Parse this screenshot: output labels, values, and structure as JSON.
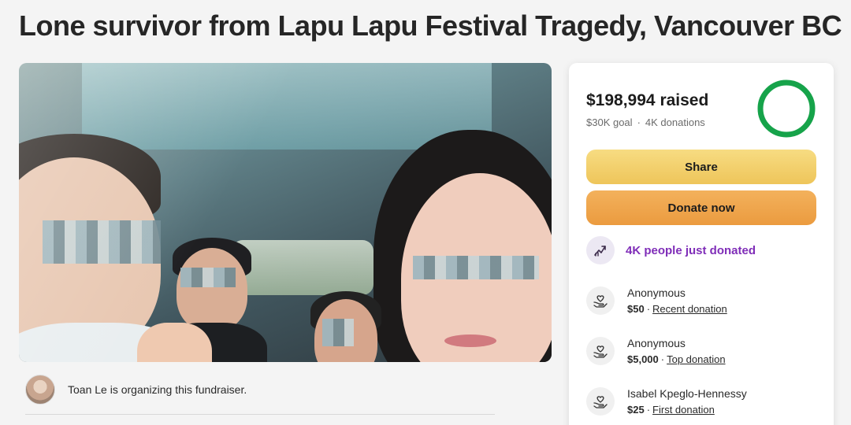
{
  "page": {
    "title": "Lone survivor from Lapu Lapu Festival Tragedy, Vancouver BC"
  },
  "organizer": {
    "text": "Toan Le is organizing this fundraiser."
  },
  "donation_card": {
    "raised_amount": "$198,994",
    "raised_suffix": "raised",
    "goal": "$30K goal",
    "donation_count": "4K donations",
    "progress_fraction": 1.0,
    "accent_color": "#16a34a",
    "share_label": "Share",
    "donate_label": "Donate now",
    "trend_text": "4K people just donated",
    "trend_icon": "trending-up-icon",
    "donors": [
      {
        "name": "Anonymous",
        "amount": "$50",
        "kind": "Recent donation",
        "icon": "heart-hand-icon"
      },
      {
        "name": "Anonymous",
        "amount": "$5,000",
        "kind": "Top donation",
        "icon": "heart-hand-icon"
      },
      {
        "name": "Isabel Kpeglo-Hennessy",
        "amount": "$25",
        "kind": "First donation",
        "icon": "heart-hand-icon"
      }
    ]
  }
}
